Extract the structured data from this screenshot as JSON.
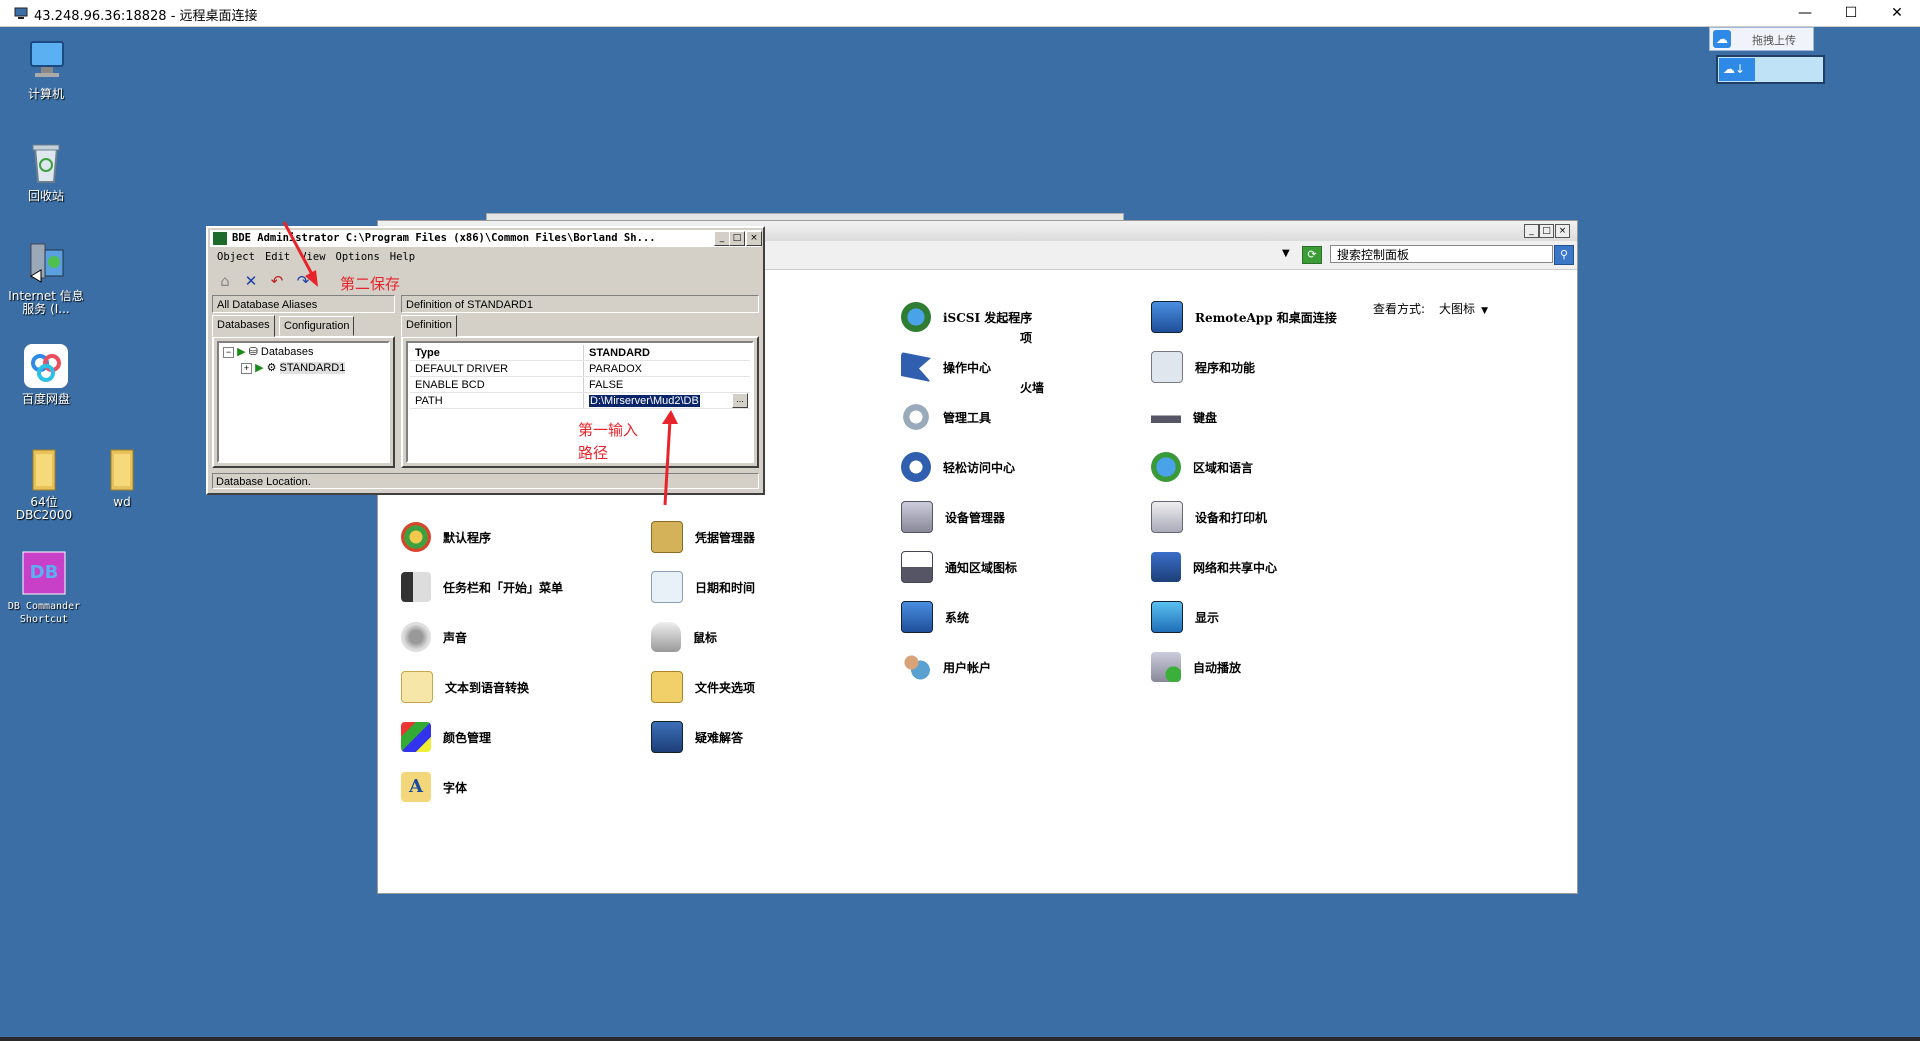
{
  "rdp": {
    "title": "43.248.96.36:18828 - 远程桌面连接",
    "minimize": "—",
    "maximize": "☐",
    "close": "✕"
  },
  "desktop_icons": [
    {
      "label": "计算机",
      "icon": "computer-icon"
    },
    {
      "label": "回收站",
      "icon": "recycle-bin-icon"
    },
    {
      "label": "Internet 信息服务 (I...",
      "icon": "iis-icon"
    },
    {
      "label": "百度网盘",
      "icon": "baidu-netdisk-icon"
    },
    {
      "label": "64位DBC2000",
      "icon": "folder-icon"
    },
    {
      "label": "wd",
      "icon": "folder-icon"
    },
    {
      "label": "DB Commander Shortcut",
      "icon": "db-commander-icon"
    }
  ],
  "baidu": {
    "upload_label": "拖拽上传",
    "download_arrow": "↓"
  },
  "control_panel": {
    "search_placeholder": "搜索控制面板",
    "view_label": "查看方式:",
    "view_value": "大图标",
    "items": [
      {
        "label": "项",
        "icon": "folder-icon"
      },
      {
        "label": "火墙",
        "icon": "firewall-icon"
      },
      {
        "label": "默认程序",
        "icon": "default-programs-icon"
      },
      {
        "label": "任务栏和「开始」菜单",
        "icon": "taskbar-icon"
      },
      {
        "label": "声音",
        "icon": "sound-icon"
      },
      {
        "label": "文本到语音转换",
        "icon": "speech-icon"
      },
      {
        "label": "颜色管理",
        "icon": "color-management-icon"
      },
      {
        "label": "字体",
        "icon": "fonts-icon"
      },
      {
        "label": "凭据管理器",
        "icon": "credential-icon"
      },
      {
        "label": "日期和时间",
        "icon": "datetime-icon"
      },
      {
        "label": "鼠标",
        "icon": "mouse-icon"
      },
      {
        "label": "文件夹选项",
        "icon": "folder-options-icon"
      },
      {
        "label": "疑难解答",
        "icon": "troubleshoot-icon"
      },
      {
        "label": "iSCSI 发起程序",
        "icon": "iscsi-icon"
      },
      {
        "label": "操作中心",
        "icon": "action-center-icon"
      },
      {
        "label": "管理工具",
        "icon": "admin-tools-icon"
      },
      {
        "label": "轻松访问中心",
        "icon": "ease-of-access-icon"
      },
      {
        "label": "设备管理器",
        "icon": "device-manager-icon"
      },
      {
        "label": "通知区域图标",
        "icon": "notification-icon"
      },
      {
        "label": "系统",
        "icon": "system-icon"
      },
      {
        "label": "用户帐户",
        "icon": "user-accounts-icon"
      },
      {
        "label": "RemoteApp 和桌面连接",
        "icon": "remoteapp-icon"
      },
      {
        "label": "程序和功能",
        "icon": "programs-icon"
      },
      {
        "label": "键盘",
        "icon": "keyboard-icon"
      },
      {
        "label": "区域和语言",
        "icon": "region-icon"
      },
      {
        "label": "设备和打印机",
        "icon": "printer-icon"
      },
      {
        "label": "网络和共享中心",
        "icon": "network-icon"
      },
      {
        "label": "显示",
        "icon": "display-icon"
      },
      {
        "label": "自动播放",
        "icon": "autoplay-icon"
      }
    ]
  },
  "bde": {
    "title": "BDE Administrator  C:\\Program Files (x86)\\Common Files\\Borland Sh...",
    "menu": [
      "Object",
      "Edit",
      "View",
      "Options",
      "Help"
    ],
    "left_header": "All Database Aliases",
    "right_header": "Definition of STANDARD1",
    "tabs_left": [
      "Databases",
      "Configuration"
    ],
    "tab_right": "Definition",
    "tree": {
      "root": "Databases",
      "child": "STANDARD1"
    },
    "definition": [
      {
        "key": "Type",
        "value": "STANDARD"
      },
      {
        "key": "DEFAULT DRIVER",
        "value": "PARADOX"
      },
      {
        "key": "ENABLE BCD",
        "value": "FALSE"
      },
      {
        "key": "PATH",
        "value": "D:\\Mirserver\\Mud2\\DB"
      }
    ],
    "dots": "...",
    "status": "Database Location."
  },
  "annotations": {
    "save": "第二保存",
    "input_line1": "第一输入",
    "input_line2": "路径"
  },
  "colors": {
    "desktop": "#3a6ea5",
    "annotation": "#e8242b",
    "selection": "#0a246a"
  }
}
